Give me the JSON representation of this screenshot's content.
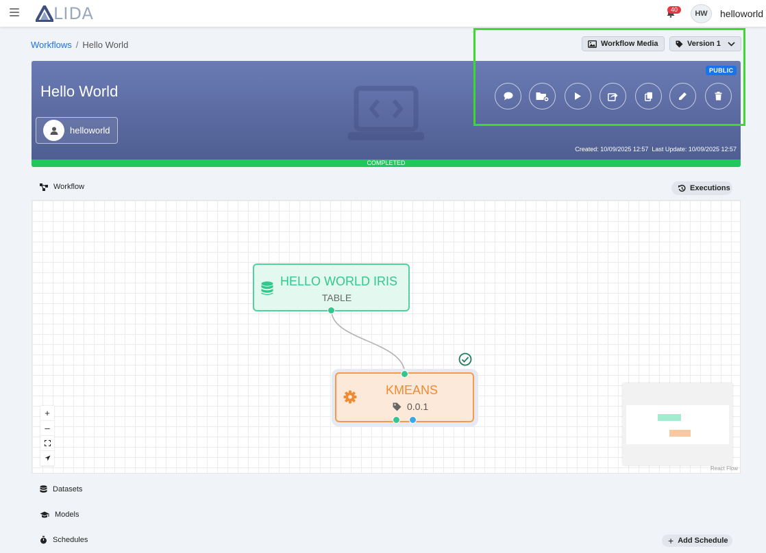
{
  "topbar": {
    "logo_text": "LIDA",
    "notification_count": "40",
    "avatar_initials": "HW",
    "username": "helloworld"
  },
  "breadcrumb": {
    "root": "Workflows",
    "separator": "/",
    "current": "Hello World"
  },
  "toolbar": {
    "media_label": "Workflow Media",
    "version_label": "Version 1"
  },
  "header": {
    "title": "Hello World",
    "owner": "helloworld",
    "visibility": "PUBLIC",
    "created": "Created: 10/09/2025 12:57",
    "updated": "Last Update: 10/09/2025 12:57",
    "status": "COMPLETED",
    "actions": [
      "comment-icon",
      "folder-settings-icon",
      "play-icon",
      "share-icon",
      "copy-icon",
      "edit-icon",
      "delete-icon"
    ]
  },
  "workflow": {
    "section_label": "Workflow",
    "executions_label": "Executions",
    "nodes": {
      "dataset": {
        "title": "HELLO WORLD IRIS",
        "subtitle": "TABLE"
      },
      "model": {
        "title": "KMEANS",
        "version": "0.0.1"
      }
    },
    "zoom": {
      "zoom_in": "+",
      "zoom_out": "–"
    },
    "attribution": "React Flow"
  },
  "sections": {
    "datasets": "Datasets",
    "models": "Models",
    "schedules": "Schedules",
    "add_schedule": "Add Schedule"
  },
  "colors": {
    "accent": "#1a73e8",
    "status_green": "#22c55e",
    "dataset_node": "#4fd39d",
    "model_node": "#f39a4e",
    "highlight": "#3dd92f"
  }
}
